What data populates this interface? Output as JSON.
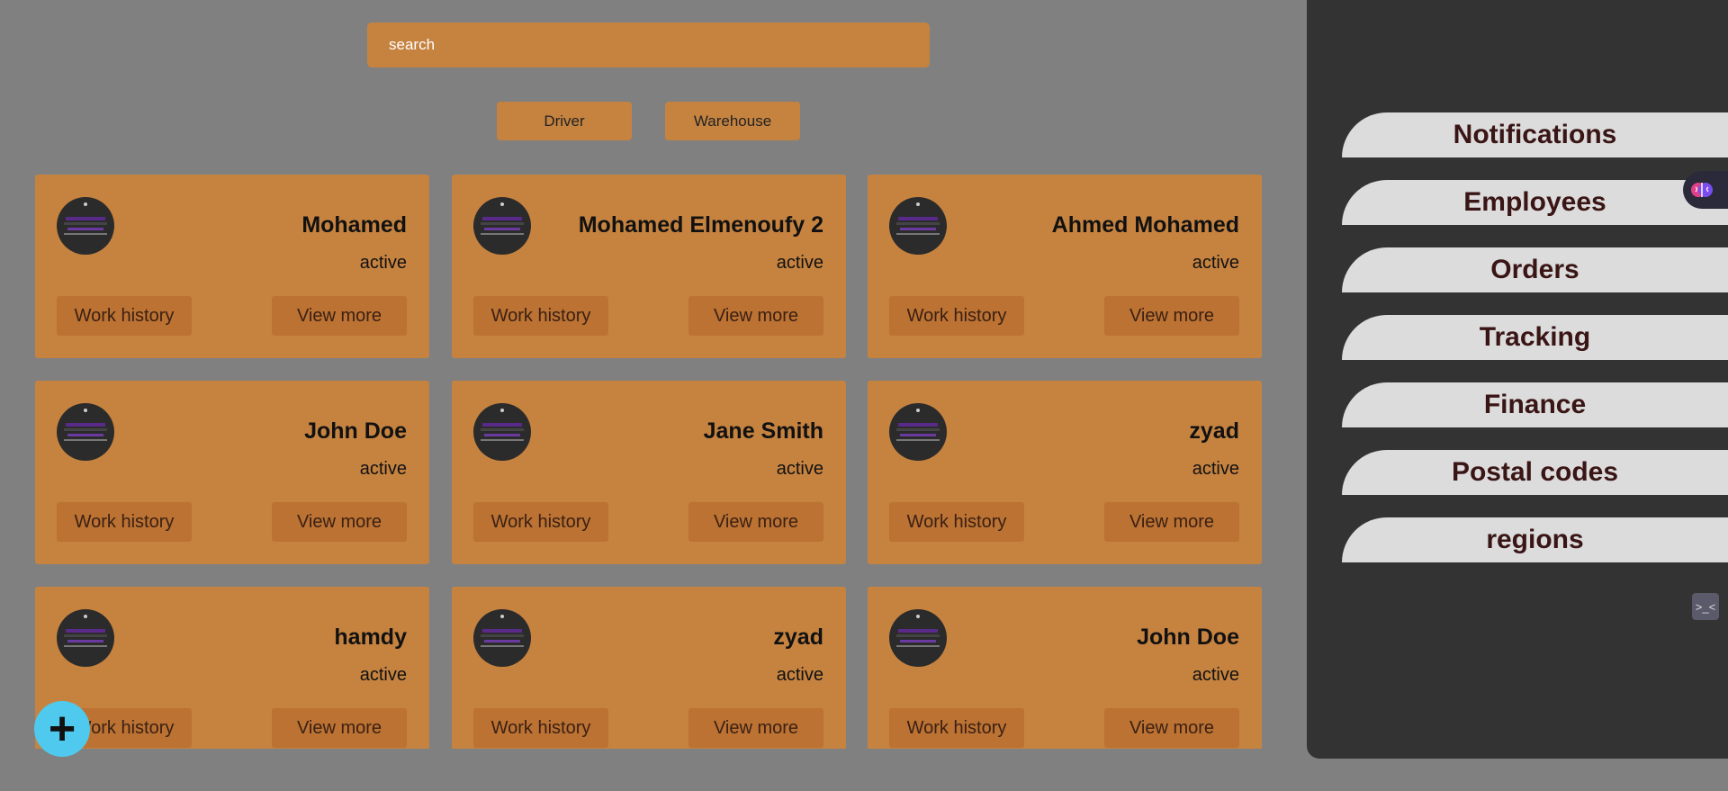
{
  "search": {
    "placeholder": "search"
  },
  "filters": [
    "Driver",
    "Warehouse"
  ],
  "cards": [
    {
      "name": "Mohamed",
      "status": "active"
    },
    {
      "name": "Mohamed Elmenoufy 2",
      "status": "active"
    },
    {
      "name": "Ahmed Mohamed",
      "status": "active"
    },
    {
      "name": "John Doe",
      "status": "active"
    },
    {
      "name": "Jane Smith",
      "status": "active"
    },
    {
      "name": "zyad",
      "status": "active"
    },
    {
      "name": "hamdy",
      "status": "active"
    },
    {
      "name": "zyad",
      "status": "active"
    },
    {
      "name": "John Doe",
      "status": "active"
    }
  ],
  "card_buttons": {
    "work_history": "Work history",
    "view_more": "View more"
  },
  "fab": {
    "icon": "plus-icon",
    "label": "+"
  },
  "sidebar": {
    "items": [
      "Notifications",
      "Employees",
      "Orders",
      "Tracking",
      "Finance",
      "Postal codes",
      "regions"
    ]
  },
  "extensions": {
    "brain": "brain-icon",
    "bot": "bot-icon",
    "bot_glyph": ">_<"
  },
  "colors": {
    "background": "#808080",
    "accent": "#c68340",
    "button": "#bb7232",
    "sidebar": "#333333",
    "nav_item": "#dcdcdc",
    "nav_text": "#3a1515",
    "fab": "#4fc9ee"
  }
}
